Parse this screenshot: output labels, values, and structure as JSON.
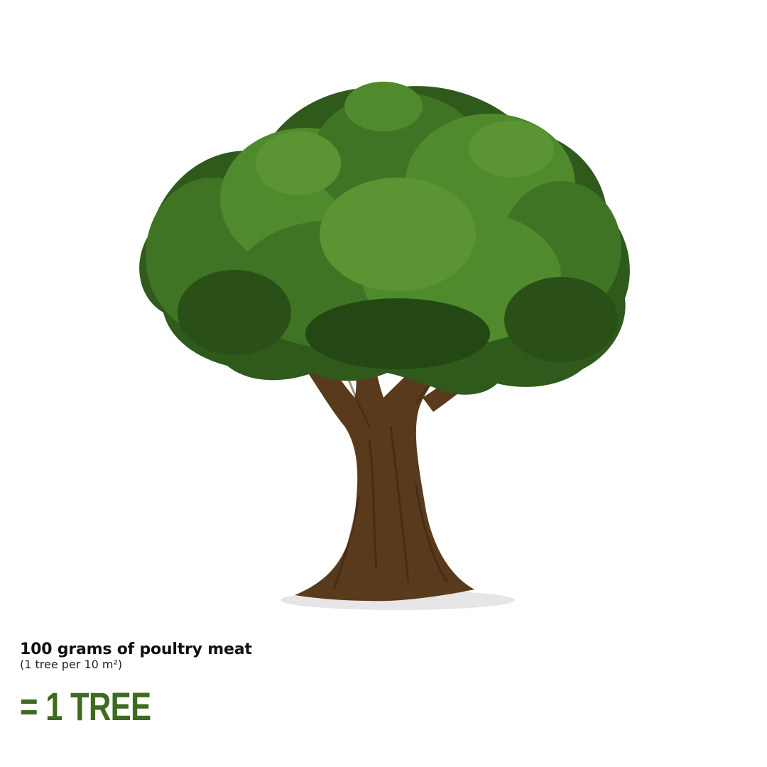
{
  "caption": {
    "title": "100 grams of poultry meat",
    "subtitle": "(1 tree per 10 m²)"
  },
  "result": {
    "text": "= 1 TREE"
  },
  "colors": {
    "accent_green": "#3e6b1f",
    "foliage_dark": "#2f5a1b",
    "foliage_mid": "#3f7424",
    "foliage_light": "#4f8a2c",
    "trunk": "#5a3a1c"
  },
  "illustration": {
    "icon": "tree-icon"
  }
}
